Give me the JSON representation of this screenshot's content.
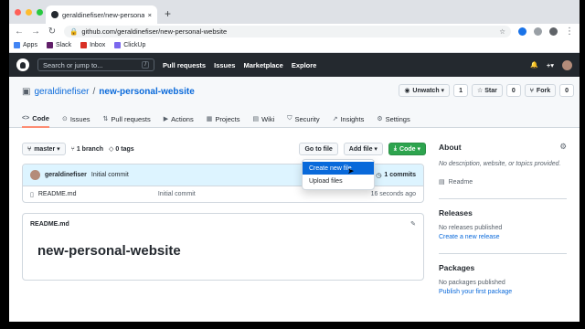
{
  "browser": {
    "tab_title": "geraldinefiser/new-personal-w",
    "tab_close": "×",
    "new_tab": "+",
    "url": "github.com/geraldinefiser/new-personal-website",
    "bookmarks": [
      {
        "label": "Apps",
        "color": "#4285f4"
      },
      {
        "label": "Slack",
        "color": "#611f69"
      },
      {
        "label": "Inbox",
        "color": "#d93025"
      },
      {
        "label": "ClickUp",
        "color": "#7b68ee"
      }
    ]
  },
  "gh": {
    "search_placeholder": "Search or jump to...",
    "search_key": "/",
    "nav": [
      "Pull requests",
      "Issues",
      "Marketplace",
      "Explore"
    ],
    "plus": "+▾",
    "bell": "🔔"
  },
  "repo": {
    "owner": "geraldinefiser",
    "sep": "/",
    "name": "new-personal-website",
    "unwatch": "Unwatch ▾",
    "watch_count": "1",
    "star": "☆ Star",
    "star_count": "0",
    "fork": "Fork",
    "fork_count": "0",
    "tabs": [
      {
        "icon": "<>",
        "label": "Code"
      },
      {
        "icon": "⊙",
        "label": "Issues"
      },
      {
        "icon": "⇅",
        "label": "Pull requests"
      },
      {
        "icon": "▶",
        "label": "Actions"
      },
      {
        "icon": "▦",
        "label": "Projects"
      },
      {
        "icon": "▤",
        "label": "Wiki"
      },
      {
        "icon": "⛉",
        "label": "Security"
      },
      {
        "icon": "↗",
        "label": "Insights"
      },
      {
        "icon": "⚙",
        "label": "Settings"
      }
    ]
  },
  "toolbar": {
    "branch": "master ▾",
    "branches": "1 branch",
    "tags": "0 tags",
    "goto_file": "Go to file",
    "add_file": "Add file ▾",
    "code": "Code ▾"
  },
  "commit": {
    "author": "geraldinefiser",
    "message": "Initial commit",
    "count": "1 commits"
  },
  "files": [
    {
      "name": "README.md",
      "message": "Initial commit",
      "age": "16 seconds ago"
    }
  ],
  "dropdown": {
    "items": [
      "Create new file",
      "Upload files"
    ]
  },
  "readme": {
    "title": "README.md",
    "heading": "new-personal-website"
  },
  "sidebar": {
    "about": "About",
    "description": "No description, website, or topics provided.",
    "readme_link": "Readme",
    "releases": "Releases",
    "releases_none": "No releases published",
    "releases_link": "Create a new release",
    "packages": "Packages",
    "packages_none": "No packages published",
    "packages_link": "Publish your first package"
  }
}
